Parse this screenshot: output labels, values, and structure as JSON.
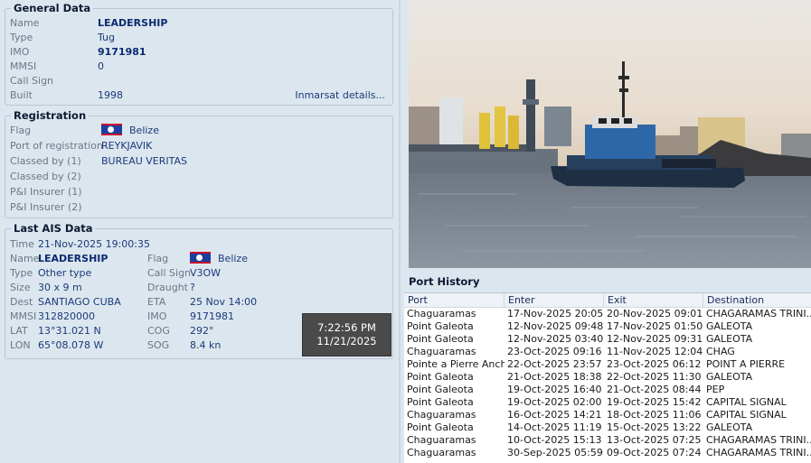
{
  "general": {
    "legend": "General Data",
    "rows": [
      {
        "label": "Name",
        "value": "LEADERSHIP"
      },
      {
        "label": "Type",
        "value": "Tug"
      },
      {
        "label": "IMO",
        "value": "9171981"
      },
      {
        "label": "MMSI",
        "value": "0"
      },
      {
        "label": "Call Sign",
        "value": ""
      },
      {
        "label": "Built",
        "value": "1998"
      }
    ],
    "inmarsat_link": "Inmarsat details..."
  },
  "registration": {
    "legend": "Registration",
    "rows": [
      {
        "label": "Flag",
        "value": "Belize"
      },
      {
        "label": "Port of registration",
        "value": "REYKJAVIK"
      },
      {
        "label": "Classed by (1)",
        "value": "BUREAU VERITAS"
      },
      {
        "label": "Classed by (2)",
        "value": ""
      },
      {
        "label": "P&I Insurer (1)",
        "value": ""
      },
      {
        "label": "P&I Insurer (2)",
        "value": ""
      }
    ]
  },
  "ais": {
    "legend": "Last AIS Data",
    "time_label": "Time",
    "time": "21-Nov-2025 19:00:35",
    "name_label": "Name",
    "name": "LEADERSHIP",
    "type_label": "Type",
    "type": "Other type",
    "size_label": "Size",
    "size": "30 x 9 m",
    "dest_label": "Dest",
    "dest": "SANTIAGO CUBA",
    "mmsi_label": "MMSI",
    "mmsi": "312820000",
    "lat_label": "LAT",
    "lat": "13°31.021 N",
    "lon_label": "LON",
    "lon": "65°08.078 W",
    "flag_label": "Flag",
    "flag": "Belize",
    "callsign_label": "Call Sign",
    "callsign": "V3OW",
    "draught_label": "Draught",
    "draught": "?",
    "eta_label": "ETA",
    "eta": "25 Nov 14:00",
    "imo_label": "IMO",
    "imo": "9171981",
    "cog_label": "COG",
    "cog": "292°",
    "sog_label": "SOG",
    "sog": "8.4 kn"
  },
  "clock": {
    "time": "7:22:56 PM",
    "date": "11/21/2025"
  },
  "port_history": {
    "legend": "Port History",
    "columns": [
      "Port",
      "Enter",
      "Exit",
      "Destination"
    ],
    "rows": [
      [
        "Chaguaramas",
        "17-Nov-2025 20:05",
        "20-Nov-2025 09:01",
        "CHAGARAMAS TRINI..."
      ],
      [
        "Point Galeota",
        "12-Nov-2025 09:48",
        "17-Nov-2025 01:50",
        "GALEOTA"
      ],
      [
        "Point Galeota",
        "12-Nov-2025 03:40",
        "12-Nov-2025 09:31",
        "GALEOTA"
      ],
      [
        "Chaguaramas",
        "23-Oct-2025 09:16",
        "11-Nov-2025 12:04",
        "CHAG"
      ],
      [
        "Pointe a Pierre Anch.",
        "22-Oct-2025 23:57",
        "23-Oct-2025 06:12",
        "POINT A PIERRE"
      ],
      [
        "Point Galeota",
        "21-Oct-2025 18:38",
        "22-Oct-2025 11:30",
        "GALEOTA"
      ],
      [
        "Point Galeota",
        "19-Oct-2025 16:40",
        "21-Oct-2025 08:44",
        "PEP"
      ],
      [
        "Point Galeota",
        "19-Oct-2025 02:00",
        "19-Oct-2025 15:42",
        "CAPITAL SIGNAL"
      ],
      [
        "Chaguaramas",
        "16-Oct-2025 14:21",
        "18-Oct-2025 11:06",
        "CAPITAL SIGNAL"
      ],
      [
        "Point Galeota",
        "14-Oct-2025 11:19",
        "15-Oct-2025 13:22",
        "GALEOTA"
      ],
      [
        "Chaguaramas",
        "10-Oct-2025 15:13",
        "13-Oct-2025 07:25",
        "CHAGARAMAS TRINI..."
      ],
      [
        "Chaguaramas",
        "30-Sep-2025 05:59",
        "09-Oct-2025 07:24",
        "CHAGARAMAS TRINI..."
      ]
    ]
  }
}
